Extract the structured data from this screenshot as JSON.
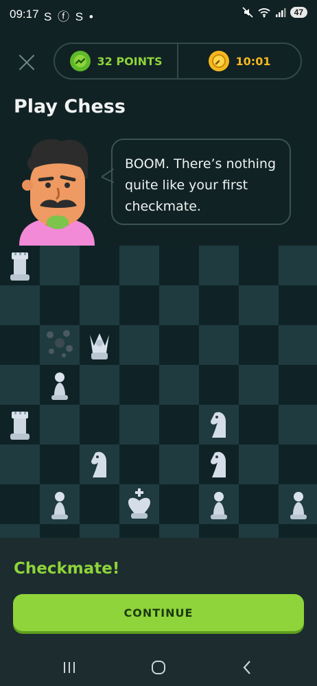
{
  "status_bar": {
    "time": "09:17",
    "left_icons": "S ⓕ S •",
    "battery": "47"
  },
  "header": {
    "points": "32 POINTS",
    "timer": "10:01"
  },
  "title": "Play Chess",
  "dialogue": "BOOM. There’s nothing quite like your first checkmate.",
  "result_label": "Checkmate!",
  "continue_label": "CONTINUE",
  "colors": {
    "accent": "#8fd43a",
    "timer": "#f6b820",
    "background": "#112224"
  },
  "board_pieces": [
    {
      "square": "a8",
      "piece": "rook-white"
    },
    {
      "square": "c6",
      "piece": "queen-white"
    },
    {
      "square": "b6",
      "piece": "captured-king-black"
    },
    {
      "square": "b5",
      "piece": "pawn-white"
    },
    {
      "square": "a4",
      "piece": "rook-white"
    },
    {
      "square": "f4",
      "piece": "knight-white"
    },
    {
      "square": "c3",
      "piece": "knight-white"
    },
    {
      "square": "f3",
      "piece": "knight-white"
    },
    {
      "square": "b2",
      "piece": "pawn-white"
    },
    {
      "square": "d2",
      "piece": "king-white"
    },
    {
      "square": "f2",
      "piece": "pawn-white"
    },
    {
      "square": "h2",
      "piece": "pawn-white"
    }
  ]
}
